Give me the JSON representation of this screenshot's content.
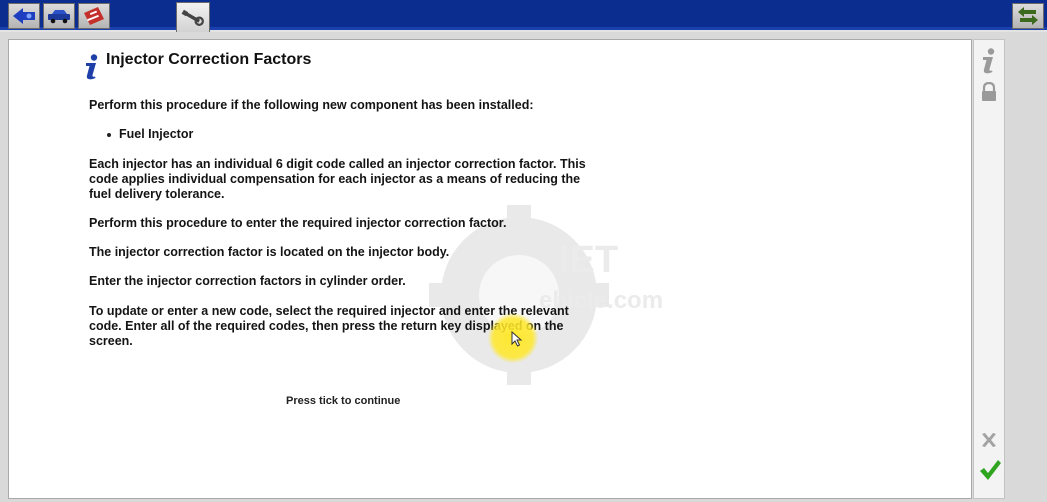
{
  "page": {
    "title": "Injector Correction Factors",
    "intro": "Perform this procedure if the following new component has been installed:",
    "components": [
      "Fuel Injector"
    ],
    "paragraphs": [
      "Each injector has an individual 6 digit code called an injector correction factor. This code applies individual compensation for each injector as a means of reducing the fuel delivery tolerance.",
      "Perform this procedure to enter the required injector correction factor.",
      "The injector correction factor is located on the injector body.",
      "Enter the injector correction factors in cylinder order.",
      "To update or enter a new code, select the required injector and enter the relevant code. Enter all of the required codes, then press the return key displayed on the screen."
    ],
    "continue_hint": "Press tick to continue"
  },
  "toolbar": {
    "buttons": [
      {
        "name": "back-arrow-icon"
      },
      {
        "name": "vehicle-icon"
      },
      {
        "name": "toolbox-icon"
      },
      {
        "name": "wrench-icon",
        "active": true
      }
    ]
  },
  "colors": {
    "toolbar_bg": "#0b2d8f",
    "tick": "#2fa51f",
    "info_icon": "#1f3fa8"
  }
}
